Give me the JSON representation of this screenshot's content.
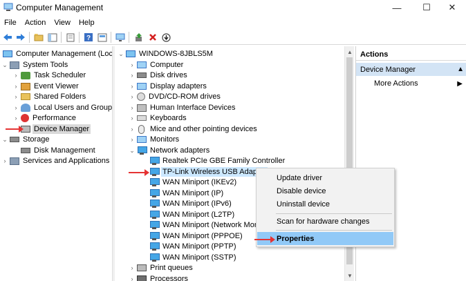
{
  "window": {
    "title": "Computer Management",
    "controls": {
      "minimize": "—",
      "maximize": "☐",
      "close": "✕"
    }
  },
  "menubar": [
    "File",
    "Action",
    "View",
    "Help"
  ],
  "left_tree": {
    "root": "Computer Management (Local",
    "system_tools": "System Tools",
    "task_scheduler": "Task Scheduler",
    "event_viewer": "Event Viewer",
    "shared_folders": "Shared Folders",
    "local_users": "Local Users and Groups",
    "performance": "Performance",
    "device_manager": "Device Manager",
    "storage": "Storage",
    "disk_management": "Disk Management",
    "services": "Services and Applications"
  },
  "device_tree": {
    "root": "WINDOWS-8JBLS5M",
    "computer": "Computer",
    "disk_drives": "Disk drives",
    "display_adapters": "Display adapters",
    "dvd": "DVD/CD-ROM drives",
    "hid": "Human Interface Devices",
    "keyboards": "Keyboards",
    "mice": "Mice and other pointing devices",
    "monitors": "Monitors",
    "network_adapters": "Network adapters",
    "adapters": [
      "Realtek PCIe GBE Family Controller",
      "TP-Link Wireless USB Adapter",
      "WAN Miniport (IKEv2)",
      "WAN Miniport (IP)",
      "WAN Miniport (IPv6)",
      "WAN Miniport (L2TP)",
      "WAN Miniport (Network Mon",
      "WAN Miniport (PPPOE)",
      "WAN Miniport (PPTP)",
      "WAN Miniport (SSTP)"
    ],
    "print_queues": "Print queues",
    "processors": "Processors"
  },
  "actions_pane": {
    "header": "Actions",
    "section": "Device Manager",
    "more": "More Actions",
    "collapse_glyph": "▲",
    "more_glyph": "▶"
  },
  "context_menu": {
    "update_driver": "Update driver",
    "disable_device": "Disable device",
    "uninstall_device": "Uninstall device",
    "scan": "Scan for hardware changes",
    "properties": "Properties"
  },
  "colors": {
    "annotation_arrow": "#e53333",
    "selection_highlight": "#cce8ff",
    "menu_active": "#91c9f7"
  }
}
